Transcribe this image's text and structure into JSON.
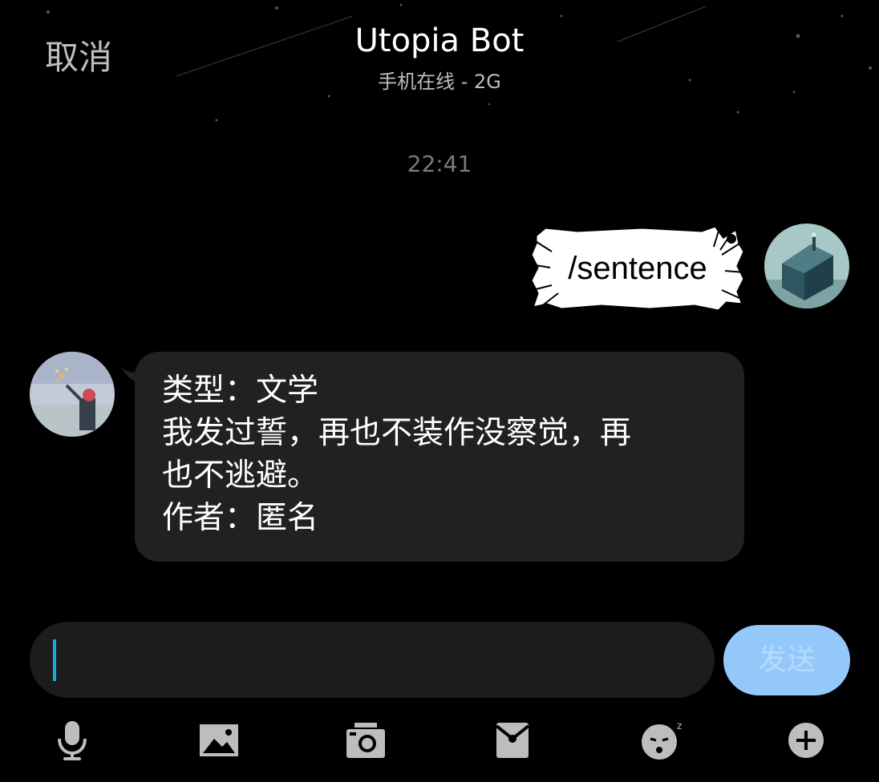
{
  "header": {
    "cancel_label": "取消",
    "title": "Utopia Bot",
    "subtitle": "手机在线 - 2G"
  },
  "chat": {
    "timestamp": "22:41",
    "outgoing": {
      "text": "/sentence"
    },
    "incoming": {
      "lines": [
        "类型：文学",
        "我发过誓，再也不装作没察觉，再",
        "也不逃避。",
        "作者：匿名"
      ]
    }
  },
  "composer": {
    "input_value": "",
    "send_label": "发送"
  },
  "toolbar": {
    "icons": [
      "microphone-icon",
      "image-icon",
      "camera-icon",
      "red-packet-icon",
      "emoji-icon",
      "plus-icon"
    ]
  },
  "colors": {
    "background": "#000000",
    "incoming_bubble": "#212121",
    "input_bg": "#1c1c1c",
    "send_button": "#94c8fb",
    "caret": "#19a8e0",
    "toolbar_icon": "#bdbdbd"
  }
}
